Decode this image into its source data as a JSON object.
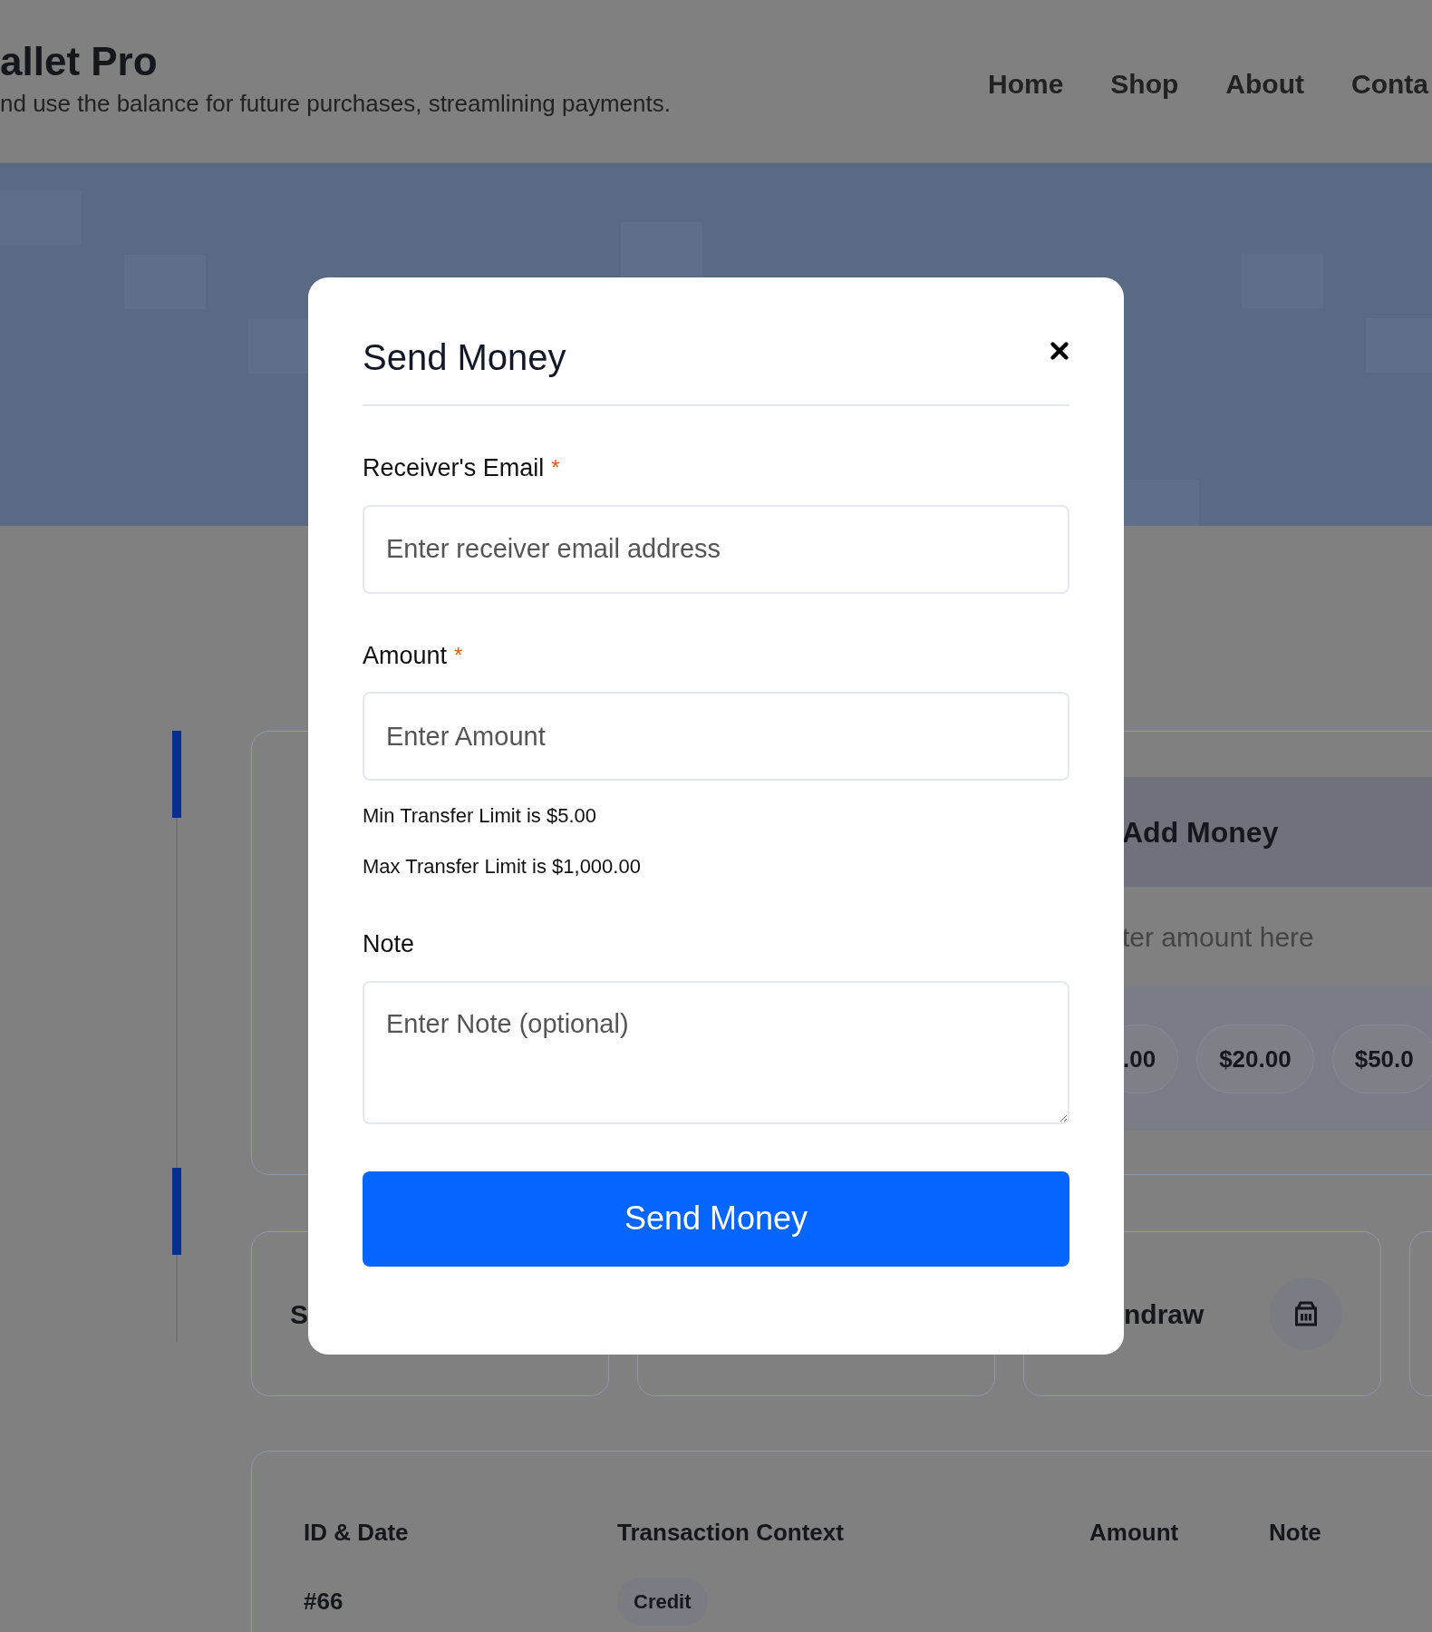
{
  "header": {
    "title": "allet Pro",
    "subtitle": "nd use the balance for future purchases, streamlining payments.",
    "nav": [
      {
        "label": "Home"
      },
      {
        "label": "Shop"
      },
      {
        "label": "About"
      },
      {
        "label": "Conta"
      }
    ]
  },
  "add_money": {
    "title": "Add Money",
    "placeholder": "ter amount here",
    "chips": [
      ".00",
      "$20.00",
      "$50.0"
    ]
  },
  "action_cards": [
    {
      "label": "S"
    },
    {
      "label": "ndraw"
    }
  ],
  "table": {
    "columns": [
      "ID & Date",
      "Transaction Context",
      "Amount",
      "Note"
    ],
    "rows": [
      {
        "id": "#66",
        "context": "Credit"
      }
    ]
  },
  "modal": {
    "title": "Send Money",
    "fields": [
      {
        "kind": "input",
        "label": "Receiver's Email",
        "required_mark": "*",
        "placeholder": "Enter receiver email address"
      },
      {
        "kind": "input",
        "label": "Amount",
        "required_mark": "*",
        "placeholder": "Enter Amount",
        "hints": [
          "Min Transfer Limit is $5.00",
          "Max Transfer Limit is $1,000.00"
        ]
      },
      {
        "kind": "textarea",
        "label": "Note",
        "placeholder": "Enter Note (optional)"
      }
    ],
    "submit": "Send Money"
  }
}
